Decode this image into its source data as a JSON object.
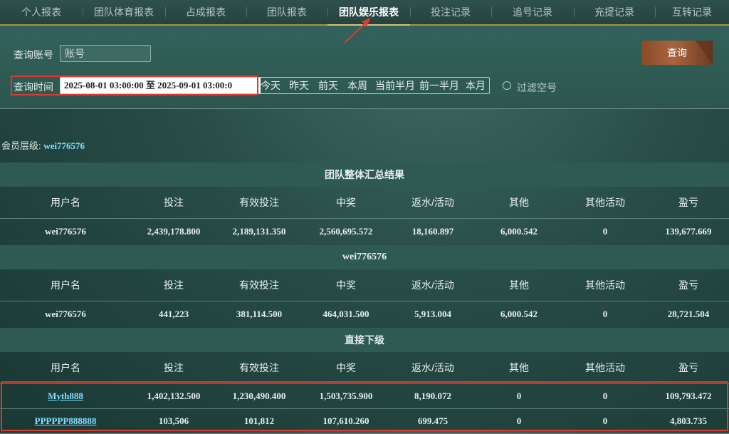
{
  "tabs": [
    "个人报表",
    "团队体育报表",
    "占成报表",
    "团队报表",
    "团队娱乐报表",
    "投注记录",
    "追号记录",
    "充提记录",
    "互转记录"
  ],
  "active_tab_index": 4,
  "filters": {
    "account_label": "查询账号",
    "account_placeholder": "账号",
    "time_label": "查询时间",
    "time_value": "2025-08-01 03:00:00 至 2025-09-01 03:00:0",
    "quick_ranges": [
      "今天",
      "昨天",
      "前天",
      "本周",
      "当前半月",
      "前一半月",
      "本月"
    ],
    "filter_empty_label": "过滤空号",
    "filter_empty_checked": false,
    "query_button": "查询"
  },
  "member_level": {
    "label": "会员层级:",
    "value": "wei776576"
  },
  "columns": [
    "用户名",
    "投注",
    "有效投注",
    "中奖",
    "返水/活动",
    "其他",
    "其他活动",
    "盈亏"
  ],
  "sections": [
    {
      "title": "团队整体汇总结果",
      "rows": [
        [
          "wei776576",
          "2,439,178.800",
          "2,189,131.350",
          "2,560,695.572",
          "18,160.897",
          "6,000.542",
          "0",
          "139,677.669"
        ]
      ],
      "link_first_col": false
    },
    {
      "title": "wei776576",
      "rows": [
        [
          "wei776576",
          "441,223",
          "381,114.500",
          "464,031.500",
          "5,913.004",
          "6,000.542",
          "0",
          "28,721.504"
        ]
      ],
      "link_first_col": false
    },
    {
      "title": "直接下级",
      "rows": [
        [
          "Myth888",
          "1,402,132.500",
          "1,230,490.400",
          "1,503,735.900",
          "8,190.072",
          "0",
          "0",
          "109,793.472"
        ],
        [
          "PPPPPP888888",
          "103,506",
          "101,812",
          "107,610.260",
          "699.475",
          "0",
          "0",
          "4,803.735"
        ]
      ],
      "link_first_col": true
    }
  ],
  "colors": {
    "accent_gold": "#d8c17a",
    "highlight_red": "#e03a2f",
    "link": "#7fe0ff",
    "button": "#a8653e"
  }
}
